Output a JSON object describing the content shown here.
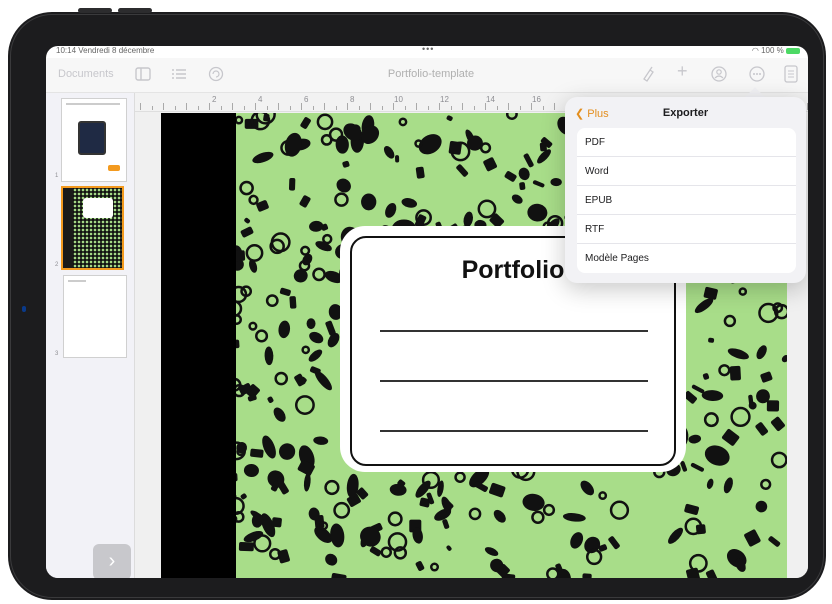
{
  "status_bar": {
    "time_date": "10:14  Vendredi 8 décembre",
    "center": "•••",
    "battery": "100 %"
  },
  "toolbar": {
    "documents_label": "Documents",
    "title": "Portfolio-template",
    "icons": [
      "sidebar-icon",
      "list-icon",
      "undo-icon",
      "format-brush-icon",
      "add-icon",
      "collaborate-icon",
      "more-icon",
      "document-setup-icon"
    ]
  },
  "ruler": {
    "numbers": [
      "2",
      "4",
      "6",
      "8",
      "10",
      "12",
      "14",
      "16"
    ]
  },
  "sidebar": {
    "pages": [
      {
        "number": "1",
        "selected": false
      },
      {
        "number": "2",
        "selected": true
      },
      {
        "number": "3",
        "selected": false
      }
    ],
    "page2_title": "Portfolio",
    "next_glyph": "›",
    "add_glyph": "+"
  },
  "document": {
    "cover_title": "Portfolio",
    "pattern_color": "#a8dd89",
    "accent_color": "#f39a1f"
  },
  "export_popover": {
    "back_label": "Plus",
    "title": "Exporter",
    "options": [
      "PDF",
      "Word",
      "EPUB",
      "RTF",
      "Modèle Pages"
    ],
    "accent_color": "#e38e1e"
  }
}
